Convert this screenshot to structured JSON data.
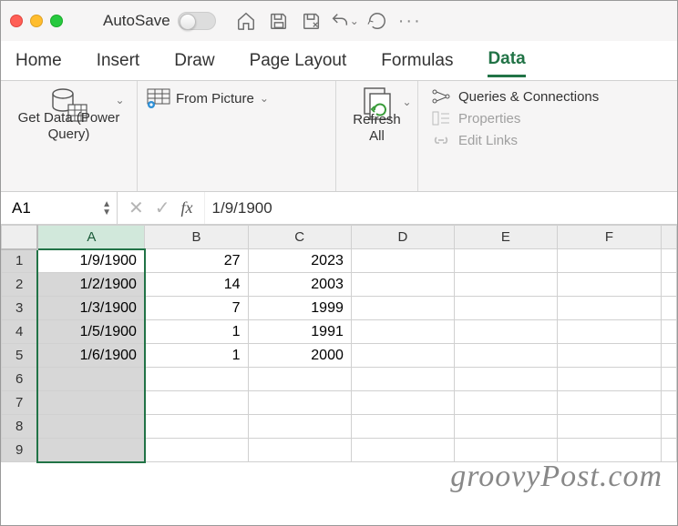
{
  "titlebar": {
    "autosave_label": "AutoSave"
  },
  "tabs": [
    "Home",
    "Insert",
    "Draw",
    "Page Layout",
    "Formulas",
    "Data"
  ],
  "active_tab": 5,
  "ribbon": {
    "get_data_label": "Get Data (Power\nQuery)",
    "from_picture_label": "From Picture",
    "refresh_all_label": "Refresh\nAll",
    "queries_label": "Queries & Connections",
    "properties_label": "Properties",
    "edit_links_label": "Edit Links"
  },
  "formula_bar": {
    "name_box": "A1",
    "value": "1/9/1900"
  },
  "columns": [
    "A",
    "B",
    "C",
    "D",
    "E",
    "F"
  ],
  "selected_column": "A",
  "rows": [
    {
      "n": 1,
      "sel": true,
      "A": "1/9/1900",
      "B": "27",
      "C": "2023"
    },
    {
      "n": 2,
      "sel": true,
      "A": "1/2/1900",
      "B": "14",
      "C": "2003"
    },
    {
      "n": 3,
      "sel": true,
      "A": "1/3/1900",
      "B": "7",
      "C": "1999"
    },
    {
      "n": 4,
      "sel": true,
      "A": "1/5/1900",
      "B": "1",
      "C": "1991"
    },
    {
      "n": 5,
      "sel": true,
      "A": "1/6/1900",
      "B": "1",
      "C": "2000"
    },
    {
      "n": 6,
      "sel": true
    },
    {
      "n": 7,
      "sel": true
    },
    {
      "n": 8,
      "sel": true
    },
    {
      "n": 9,
      "sel": true
    }
  ],
  "watermark": "groovyPost.com"
}
